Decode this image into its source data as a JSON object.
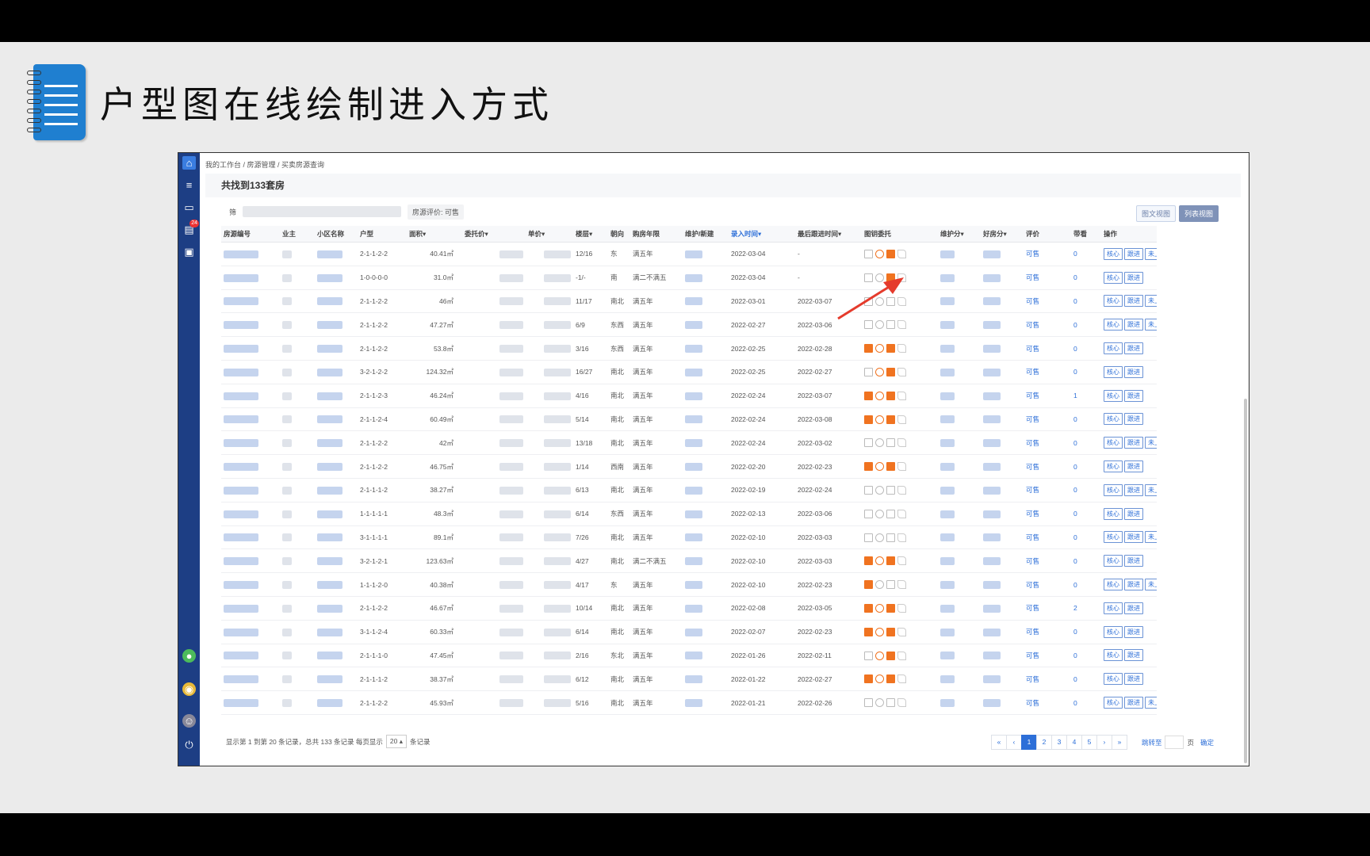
{
  "slide_title": "户型图在线绘制进入方式",
  "app": {
    "breadcrumb": "我的工作台 / 房源管理 / 买卖房源查询",
    "found_text": "共找到133套房",
    "filter_prefix": "筛",
    "filter_chip": "房源评价: 可售",
    "view_buttons": [
      "图文视图",
      "列表视图"
    ],
    "notification_count": "24",
    "columns": [
      "房源编号",
      "业主",
      "小区名称",
      "户型",
      "面积▾",
      "委托价▾",
      "单价▾",
      "楼层▾",
      "朝向",
      "购房年限",
      "维护/新建",
      "录入时间▾",
      "最后跟进时间▾",
      "图钥委托",
      "维护分▾",
      "好房分▾",
      "评价",
      "带看",
      "操作"
    ],
    "rows": [
      {
        "type": "2-1-1-2-2",
        "area": "40.41㎡",
        "floor": "12/16",
        "dir": "东",
        "years": "满五年",
        "entry": "2022-03-04",
        "follow": "-",
        "eval": "可售",
        "views": "0",
        "cam": false,
        "key": true,
        "doc": true,
        "shelf": true
      },
      {
        "type": "1-0-0-0-0",
        "area": "31.0㎡",
        "floor": "-1/-",
        "dir": "南",
        "years": "满二不满五",
        "entry": "2022-03-04",
        "follow": "-",
        "eval": "可售",
        "views": "0",
        "cam": false,
        "key": false,
        "doc": true,
        "shelf": false
      },
      {
        "type": "2-1-1-2-2",
        "area": "46㎡",
        "floor": "11/17",
        "dir": "南北",
        "years": "满五年",
        "entry": "2022-03-01",
        "follow": "2022-03-07",
        "eval": "可售",
        "views": "0",
        "cam": false,
        "key": false,
        "doc": false,
        "shelf": true
      },
      {
        "type": "2-1-1-2-2",
        "area": "47.27㎡",
        "floor": "6/9",
        "dir": "东西",
        "years": "满五年",
        "entry": "2022-02-27",
        "follow": "2022-03-06",
        "eval": "可售",
        "views": "0",
        "cam": false,
        "key": false,
        "doc": false,
        "shelf": true
      },
      {
        "type": "2-1-1-2-2",
        "area": "53.8㎡",
        "floor": "3/16",
        "dir": "东西",
        "years": "满五年",
        "entry": "2022-02-25",
        "follow": "2022-02-28",
        "eval": "可售",
        "views": "0",
        "cam": true,
        "key": true,
        "doc": true,
        "shelf": false
      },
      {
        "type": "3-2-1-2-2",
        "area": "124.32㎡",
        "floor": "16/27",
        "dir": "南北",
        "years": "满五年",
        "entry": "2022-02-25",
        "follow": "2022-02-27",
        "eval": "可售",
        "views": "0",
        "cam": false,
        "key": true,
        "doc": true,
        "shelf": false
      },
      {
        "type": "2-1-1-2-3",
        "area": "46.24㎡",
        "floor": "4/16",
        "dir": "南北",
        "years": "满五年",
        "entry": "2022-02-24",
        "follow": "2022-03-07",
        "eval": "可售",
        "views": "1",
        "cam": true,
        "key": true,
        "doc": true,
        "shelf": false
      },
      {
        "type": "2-1-1-2-4",
        "area": "60.49㎡",
        "floor": "5/14",
        "dir": "南北",
        "years": "满五年",
        "entry": "2022-02-24",
        "follow": "2022-03-08",
        "eval": "可售",
        "views": "0",
        "cam": true,
        "key": true,
        "doc": true,
        "shelf": false
      },
      {
        "type": "2-1-1-2-2",
        "area": "42㎡",
        "floor": "13/18",
        "dir": "南北",
        "years": "满五年",
        "entry": "2022-02-24",
        "follow": "2022-03-02",
        "eval": "可售",
        "views": "0",
        "cam": false,
        "key": false,
        "doc": false,
        "shelf": true
      },
      {
        "type": "2-1-1-2-2",
        "area": "46.75㎡",
        "floor": "1/14",
        "dir": "西南",
        "years": "满五年",
        "entry": "2022-02-20",
        "follow": "2022-02-23",
        "eval": "可售",
        "views": "0",
        "cam": true,
        "key": true,
        "doc": true,
        "shelf": false
      },
      {
        "type": "2-1-1-1-2",
        "area": "38.27㎡",
        "floor": "6/13",
        "dir": "南北",
        "years": "满五年",
        "entry": "2022-02-19",
        "follow": "2022-02-24",
        "eval": "可售",
        "views": "0",
        "cam": false,
        "key": false,
        "doc": false,
        "shelf": true
      },
      {
        "type": "1-1-1-1-1",
        "area": "48.3㎡",
        "floor": "6/14",
        "dir": "东西",
        "years": "满五年",
        "entry": "2022-02-13",
        "follow": "2022-03-06",
        "eval": "可售",
        "views": "0",
        "cam": false,
        "key": false,
        "doc": false,
        "shelf": false
      },
      {
        "type": "3-1-1-1-1",
        "area": "89.1㎡",
        "floor": "7/26",
        "dir": "南北",
        "years": "满五年",
        "entry": "2022-02-10",
        "follow": "2022-03-03",
        "eval": "可售",
        "views": "0",
        "cam": false,
        "key": false,
        "doc": false,
        "shelf": true
      },
      {
        "type": "3-2-1-2-1",
        "area": "123.63㎡",
        "floor": "4/27",
        "dir": "南北",
        "years": "满二不满五",
        "entry": "2022-02-10",
        "follow": "2022-03-03",
        "eval": "可售",
        "views": "0",
        "cam": true,
        "key": true,
        "doc": true,
        "shelf": false
      },
      {
        "type": "1-1-1-2-0",
        "area": "40.38㎡",
        "floor": "4/17",
        "dir": "东",
        "years": "满五年",
        "entry": "2022-02-10",
        "follow": "2022-02-23",
        "eval": "可售",
        "views": "0",
        "cam": true,
        "key": false,
        "doc": false,
        "shelf": true
      },
      {
        "type": "2-1-1-2-2",
        "area": "46.67㎡",
        "floor": "10/14",
        "dir": "南北",
        "years": "满五年",
        "entry": "2022-02-08",
        "follow": "2022-03-05",
        "eval": "可售",
        "views": "2",
        "cam": true,
        "key": true,
        "doc": true,
        "shelf": false
      },
      {
        "type": "3-1-1-2-4",
        "area": "60.33㎡",
        "floor": "6/14",
        "dir": "南北",
        "years": "满五年",
        "entry": "2022-02-07",
        "follow": "2022-02-23",
        "eval": "可售",
        "views": "0",
        "cam": true,
        "key": true,
        "doc": true,
        "shelf": false
      },
      {
        "type": "2-1-1-1-0",
        "area": "47.45㎡",
        "floor": "2/16",
        "dir": "东北",
        "years": "满五年",
        "entry": "2022-01-26",
        "follow": "2022-02-11",
        "eval": "可售",
        "views": "0",
        "cam": false,
        "key": true,
        "doc": true,
        "shelf": false
      },
      {
        "type": "2-1-1-1-2",
        "area": "38.37㎡",
        "floor": "6/12",
        "dir": "南北",
        "years": "满五年",
        "entry": "2022-01-22",
        "follow": "2022-02-27",
        "eval": "可售",
        "views": "0",
        "cam": true,
        "key": true,
        "doc": true,
        "shelf": false
      },
      {
        "type": "2-1-1-2-2",
        "area": "45.93㎡",
        "floor": "5/16",
        "dir": "南北",
        "years": "满五年",
        "entry": "2022-01-21",
        "follow": "2022-02-26",
        "eval": "可售",
        "views": "0",
        "cam": false,
        "key": false,
        "doc": false,
        "shelf": true
      }
    ],
    "op_labels": {
      "core": "核心",
      "follow": "跟进",
      "shelf": "未上架"
    },
    "footer": {
      "prefix": "显示第 1 到第 20 条记录，总共 133 条记录 每页显示",
      "page_size": "20 ▴",
      "suffix": "条记录"
    },
    "pager": {
      "pages": [
        "«",
        "‹",
        "1",
        "2",
        "3",
        "4",
        "5",
        "›",
        "»"
      ],
      "active": "1",
      "jump_label": "跳转至",
      "page_unit": "页",
      "confirm": "确定"
    }
  },
  "colors": {
    "sidebar": "#1d3e84",
    "accent": "#2d6fd8",
    "arrow": "#e53b2c",
    "orange_icon": "#f07320"
  }
}
